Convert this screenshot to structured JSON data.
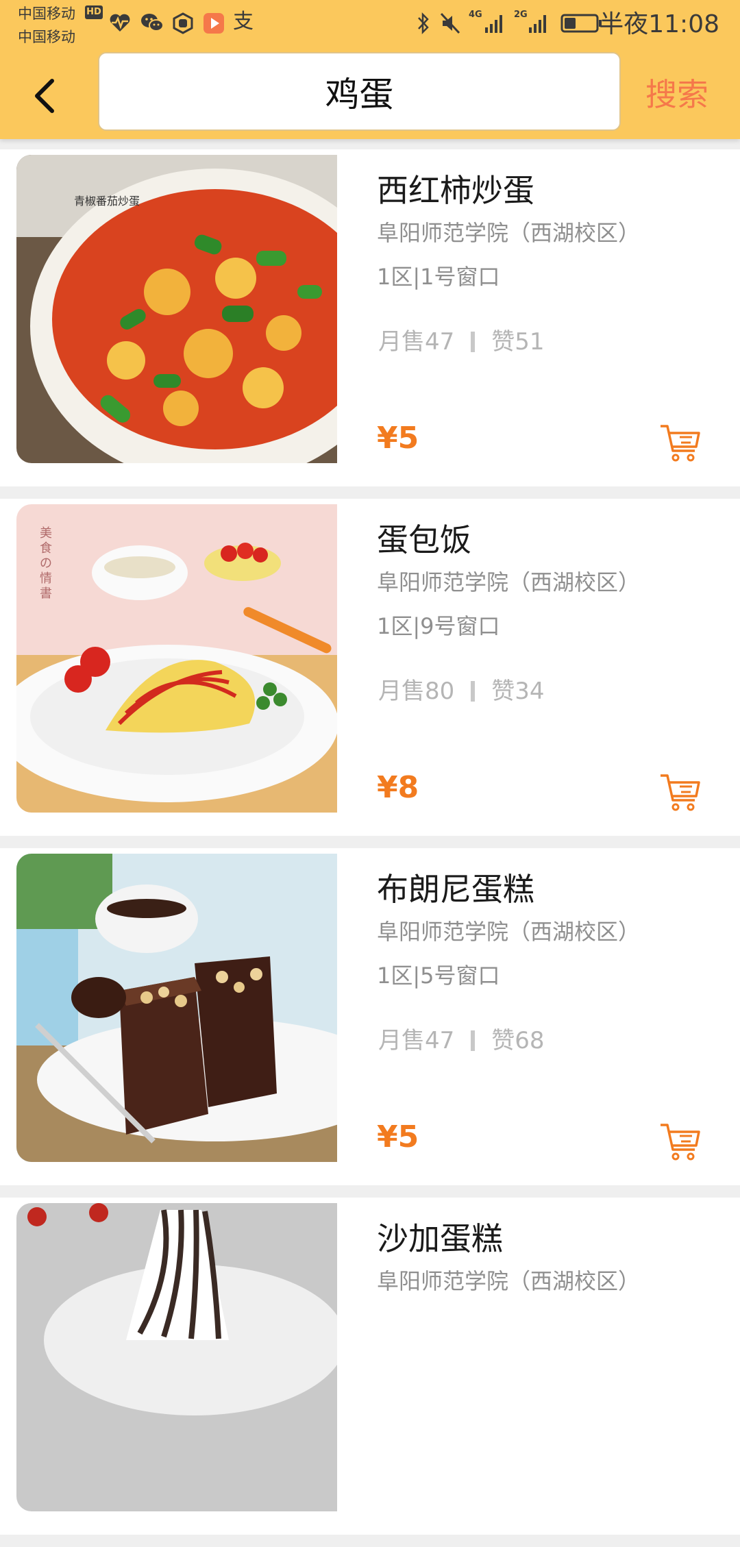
{
  "status_bar": {
    "carrier1": "中国移动",
    "carrier2": "中国移动",
    "hd": "HD",
    "alipay_glyph": "支",
    "net1": "4G",
    "net2": "2G",
    "time": "半夜11:08"
  },
  "search": {
    "query": "鸡蛋",
    "button_label": "搜索"
  },
  "colors": {
    "header_bg": "#fbc85c",
    "search_button": "#f5784a",
    "price": "#f27b1f",
    "cart_icon": "#f27b1f"
  },
  "items": [
    {
      "name": "西红柿炒蛋",
      "school": "阜阳师范学院（西湖校区）",
      "window": "1区|1号窗口",
      "monthly_sales": "月售47",
      "likes": "赞51",
      "price": "¥5",
      "image_text": "青椒番茄炒蛋"
    },
    {
      "name": "蛋包饭",
      "school": "阜阳师范学院（西湖校区）",
      "window": "1区|9号窗口",
      "monthly_sales": "月售80",
      "likes": "赞34",
      "price": "¥8",
      "image_text": "美食の情書"
    },
    {
      "name": "布朗尼蛋糕",
      "school": "阜阳师范学院（西湖校区）",
      "window": "1区|5号窗口",
      "monthly_sales": "月售47",
      "likes": "赞68",
      "price": "¥5"
    },
    {
      "name": "沙加蛋糕",
      "school": "阜阳师范学院（西湖校区）"
    }
  ]
}
